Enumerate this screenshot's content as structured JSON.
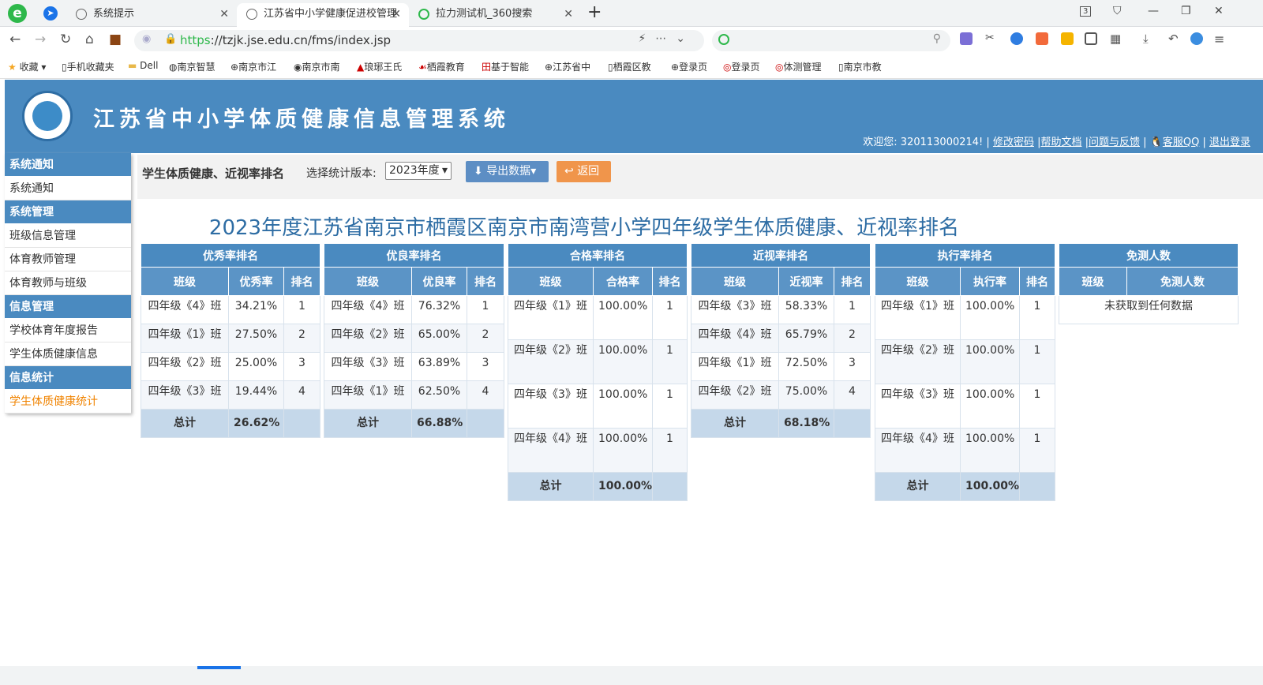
{
  "browser": {
    "tabs": [
      {
        "title": "系统提示"
      },
      {
        "title": "江苏省中小学健康促进校管理"
      },
      {
        "title": "拉力测试机_360搜索"
      }
    ],
    "url_scheme": "https",
    "url_rest": "://tzjk.jse.edu.cn/fms/index.jsp",
    "tab_count_badge": "3",
    "bookmarks": [
      "收藏",
      "手机收藏夹",
      "Dell",
      "南京智慧",
      "南京市江",
      "南京市南",
      "琅琊王氏",
      "栖霞教育",
      "基于智能",
      "江苏省中",
      "栖霞区教",
      "登录页",
      "登录页",
      "体测管理",
      "南京市教"
    ]
  },
  "header": {
    "title": "江苏省中小学体质健康信息管理系统",
    "welcome": "欢迎您: 320113000214! |",
    "links": [
      "修改密码",
      "帮助文档",
      "问题与反馈",
      "客服QQ",
      "退出登录"
    ]
  },
  "sidebar": {
    "groups": [
      {
        "title": "系统通知",
        "items": [
          "系统通知"
        ]
      },
      {
        "title": "系统管理",
        "items": [
          "班级信息管理",
          "体育教师管理",
          "体育教师与班级"
        ]
      },
      {
        "title": "信息管理",
        "items": [
          "学校体育年度报告",
          "学生体质健康信息"
        ]
      },
      {
        "title": "信息统计",
        "items": [
          "学生体质健康统计"
        ]
      }
    ]
  },
  "toolbar": {
    "title": "学生体质健康、近视率排名",
    "version_label": "选择统计版本:",
    "version_value": "2023年度",
    "export_label": "导出数据",
    "back_label": "返回"
  },
  "report_title": "2023年度江苏省南京市栖霞区南京市南湾营小学四年级学生体质健康、近视率排名",
  "tables": {
    "excellent": {
      "caption": "优秀率排名",
      "headers": [
        "班级",
        "优秀率",
        "排名"
      ],
      "rows": [
        [
          "四年级《4》班",
          "34.21%",
          "1"
        ],
        [
          "四年级《1》班",
          "27.50%",
          "2"
        ],
        [
          "四年级《2》班",
          "25.00%",
          "3"
        ],
        [
          "四年级《3》班",
          "19.44%",
          "4"
        ]
      ],
      "total_label": "总计",
      "total_value": "26.62%"
    },
    "good": {
      "caption": "优良率排名",
      "headers": [
        "班级",
        "优良率",
        "排名"
      ],
      "rows": [
        [
          "四年级《4》班",
          "76.32%",
          "1"
        ],
        [
          "四年级《2》班",
          "65.00%",
          "2"
        ],
        [
          "四年级《3》班",
          "63.89%",
          "3"
        ],
        [
          "四年级《1》班",
          "62.50%",
          "4"
        ]
      ],
      "total_label": "总计",
      "total_value": "66.88%"
    },
    "pass": {
      "caption": "合格率排名",
      "headers": [
        "班级",
        "合格率",
        "排名"
      ],
      "rows": [
        [
          "四年级《1》班",
          "100.00%",
          "1"
        ],
        [
          "四年级《2》班",
          "100.00%",
          "1"
        ],
        [
          "四年级《3》班",
          "100.00%",
          "1"
        ],
        [
          "四年级《4》班",
          "100.00%",
          "1"
        ]
      ],
      "total_label": "总计",
      "total_value": "100.00%"
    },
    "myopia": {
      "caption": "近视率排名",
      "headers": [
        "班级",
        "近视率",
        "排名"
      ],
      "rows": [
        [
          "四年级《3》班",
          "58.33%",
          "1"
        ],
        [
          "四年级《4》班",
          "65.79%",
          "2"
        ],
        [
          "四年级《1》班",
          "72.50%",
          "3"
        ],
        [
          "四年级《2》班",
          "75.00%",
          "4"
        ]
      ],
      "total_label": "总计",
      "total_value": "68.18%"
    },
    "execution": {
      "caption": "执行率排名",
      "headers": [
        "班级",
        "执行率",
        "排名"
      ],
      "rows": [
        [
          "四年级《1》班",
          "100.00%",
          "1"
        ],
        [
          "四年级《2》班",
          "100.00%",
          "1"
        ],
        [
          "四年级《3》班",
          "100.00%",
          "1"
        ],
        [
          "四年级《4》班",
          "100.00%",
          "1"
        ]
      ],
      "total_label": "总计",
      "total_value": "100.00%"
    },
    "exempt": {
      "caption": "免测人数",
      "headers": [
        "班级",
        "免测人数"
      ],
      "empty_message": "未获取到任何数据"
    }
  }
}
